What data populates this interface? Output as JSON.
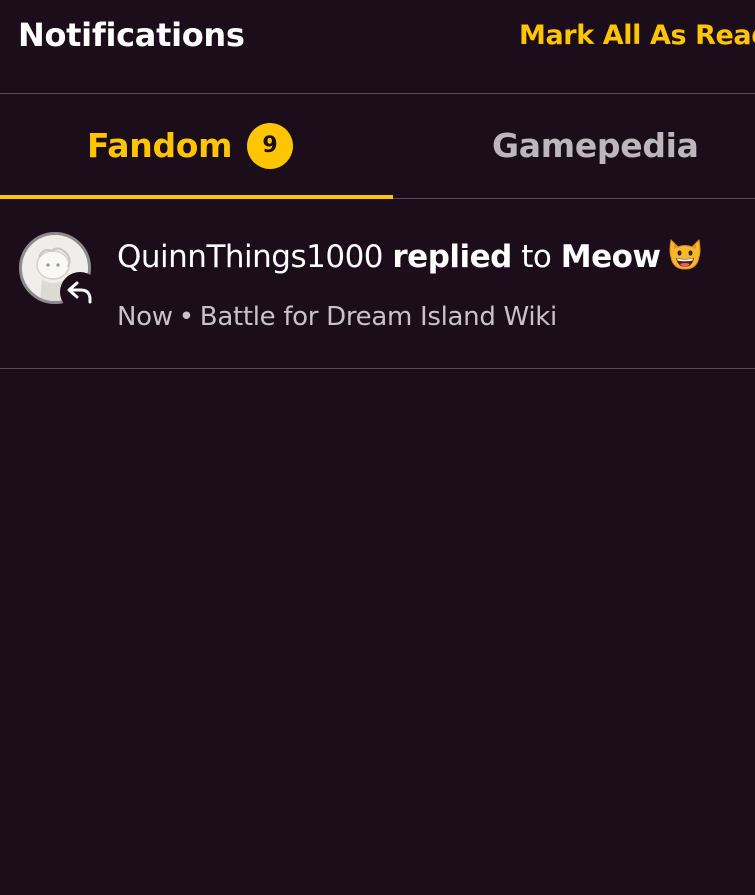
{
  "header": {
    "title": "Notifications",
    "mark_all_label": "Mark All As Read"
  },
  "tabs": [
    {
      "label": "Fandom",
      "badge": "9",
      "active": true
    },
    {
      "label": "Gamepedia",
      "active": false
    }
  ],
  "notifications": [
    {
      "user": "QuinnThings1000",
      "action": "replied",
      "connector": "to",
      "target": "Meow",
      "emoji": "grinning-cat-emoji",
      "time": "Now",
      "separator": "•",
      "wiki": "Battle for Dream Island Wiki",
      "icon": "reply-icon"
    }
  ],
  "colors": {
    "background": "#1c0d1b",
    "accent": "#ffc500",
    "divider": "#5a4a58",
    "text": "#ffffff",
    "muted": "#bdb6bc"
  }
}
